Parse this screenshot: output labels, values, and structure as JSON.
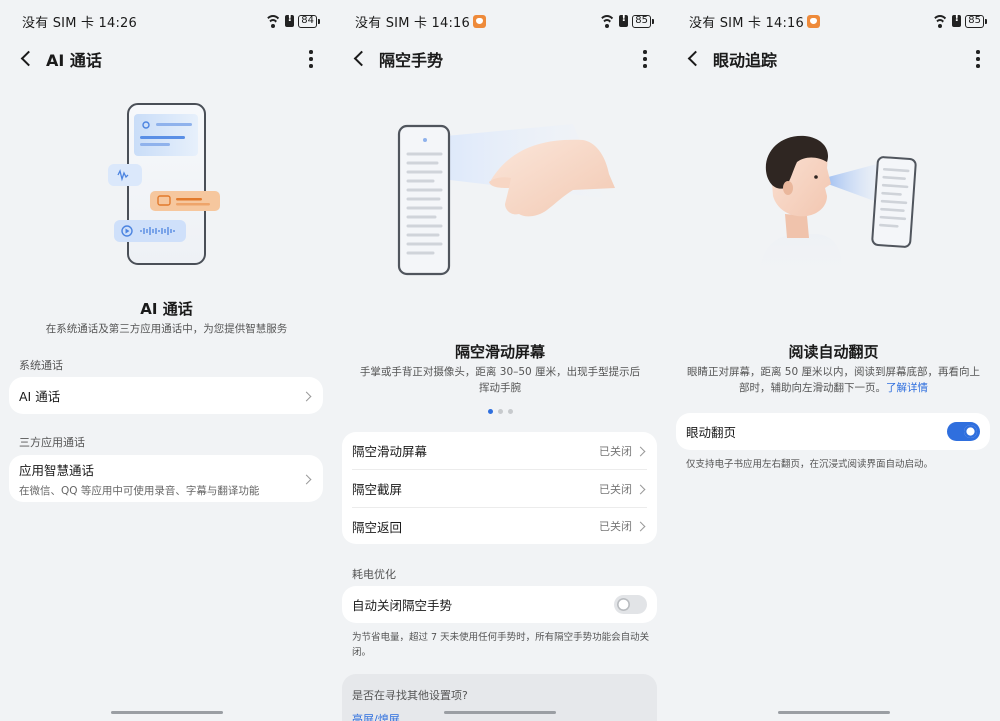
{
  "panels": [
    {
      "status": {
        "left": "没有 SIM 卡 14:26",
        "battery": "84"
      },
      "title": "AI 通话",
      "hero_title": "AI 通话",
      "hero_desc": "在系统通话及第三方应用通话中，为您提供智慧服务",
      "sections": [
        {
          "label": "系统通话",
          "items": [
            {
              "title": "AI 通话"
            }
          ]
        },
        {
          "label": "三方应用通话",
          "items": [
            {
              "title": "应用智慧通话",
              "subtitle": "在微信、QQ 等应用中可使用录音、字幕与翻译功能"
            }
          ]
        }
      ]
    },
    {
      "status": {
        "left": "没有 SIM 卡 14:16",
        "battery": "85"
      },
      "title": "隔空手势",
      "hero_title": "隔空滑动屏幕",
      "hero_desc": "手掌或手背正对摄像头，距离 30–50 厘米，出现手型提示后挥动手腕",
      "items": [
        {
          "title": "隔空滑动屏幕",
          "value": "已关闭"
        },
        {
          "title": "隔空截屏",
          "value": "已关闭"
        },
        {
          "title": "隔空返回",
          "value": "已关闭"
        }
      ],
      "power_label": "耗电优化",
      "power_item": {
        "title": "自动关闭隔空手势",
        "toggle": false
      },
      "power_note": "为节省电量，超过 7 天未使用任何手势时，所有隔空手势功能会自动关闭。",
      "suggest": {
        "question": "是否在寻找其他设置项?",
        "link": "亮屏/熄屏"
      }
    },
    {
      "status": {
        "left": "没有 SIM 卡 14:16",
        "battery": "85"
      },
      "title": "眼动追踪",
      "hero_title": "阅读自动翻页",
      "hero_desc": "眼睛正对屏幕，距离 50 厘米以内，阅读到屏幕底部，再看向上部时，辅助向左滑动翻下一页。",
      "hero_link": "了解详情",
      "item": {
        "title": "眼动翻页",
        "toggle": true
      },
      "note": "仅支持电子书应用左右翻页，在沉浸式阅读界面自动启动。"
    }
  ],
  "colors": {
    "accent": "#2f6fde",
    "background": "#f1f3f5",
    "card": "#ffffff"
  }
}
